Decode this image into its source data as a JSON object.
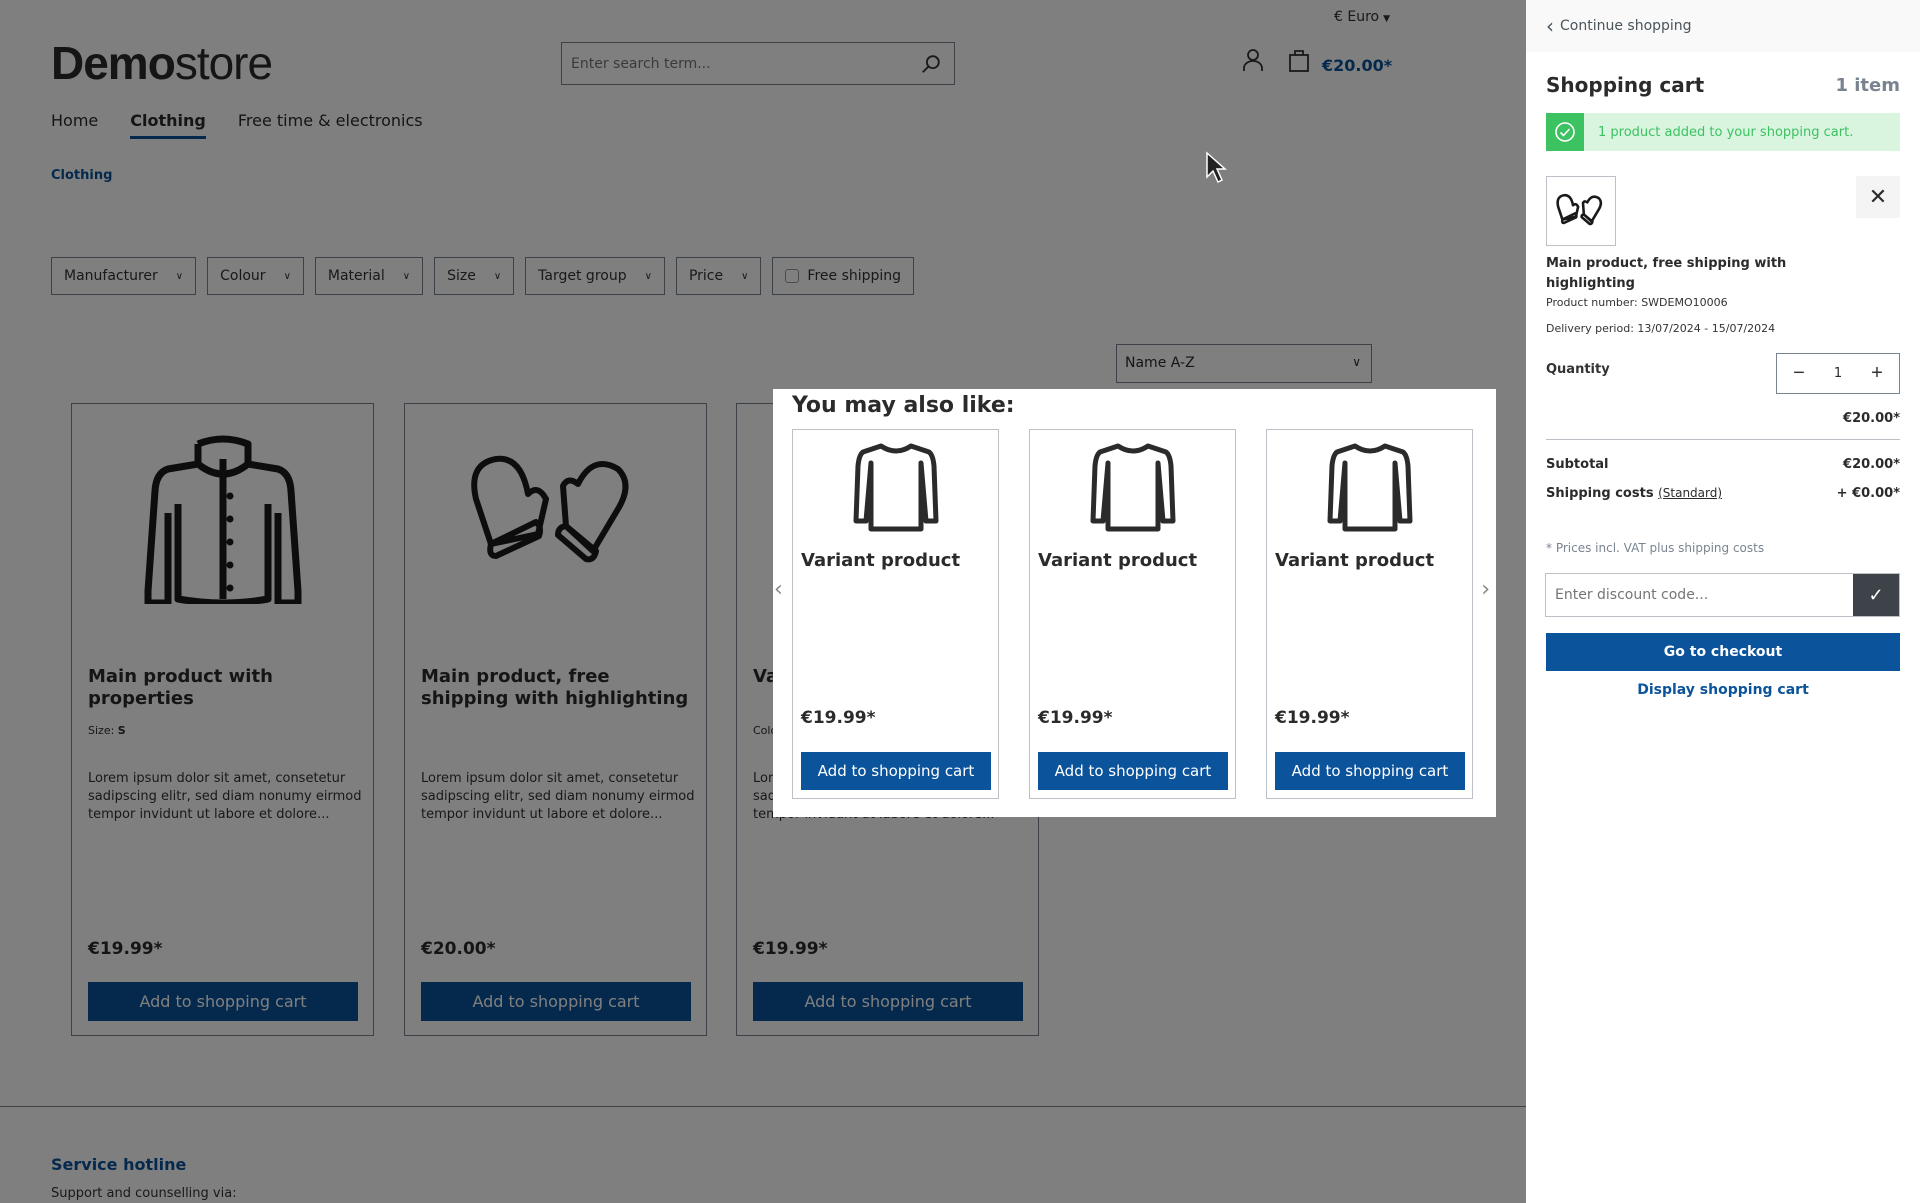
{
  "header": {
    "currency": "€ Euro",
    "logo_bold": "Demo",
    "logo_light": "store",
    "search_placeholder": "Enter search term...",
    "cart_total": "€20.00*"
  },
  "nav": {
    "items": [
      {
        "label": "Home",
        "active": false
      },
      {
        "label": "Clothing",
        "active": true
      },
      {
        "label": "Free time & electronics",
        "active": false
      }
    ]
  },
  "breadcrumb": "Clothing",
  "filters": [
    "Manufacturer",
    "Colour",
    "Material",
    "Size",
    "Target group",
    "Price"
  ],
  "free_shipping_label": "Free shipping",
  "sort": {
    "selected": "Name A-Z"
  },
  "products": [
    {
      "name": "Main product with properties",
      "prop_label": "Size:",
      "prop_value": "S",
      "desc": "Lorem ipsum dolor sit amet, consetetur sadipscing elitr, sed diam nonumy eirmod tempor invidunt ut labore et dolore...",
      "price": "€19.99*",
      "button": "Add to shopping cart",
      "image": "jacket-icon"
    },
    {
      "name": "Main product, free shipping with highlighting",
      "prop_label": "",
      "prop_value": "",
      "desc": "Lorem ipsum dolor sit amet, consetetur sadipscing elitr, sed diam nonumy eirmod tempor invidunt ut labore et dolore...",
      "price": "€20.00*",
      "button": "Add to shopping cart",
      "image": "mittens-icon"
    },
    {
      "name": "Variant product",
      "prop_label": "Colour:",
      "prop_value": "",
      "desc": "Lorem ipsum dolor sit amet, consetetur sadipscing elitr, sed diam nonumy eirmod tempor invidunt ut labore et dolore...",
      "price": "€19.99*",
      "button": "Add to shopping cart",
      "image": "shirt-icon"
    }
  ],
  "footer": {
    "title": "Service hotline",
    "text": "Support and counselling via:"
  },
  "modal": {
    "title": "You may also like:",
    "items": [
      {
        "name": "Variant product",
        "price": "€19.99*",
        "button": "Add to shopping cart"
      },
      {
        "name": "Variant product",
        "price": "€19.99*",
        "button": "Add to shopping cart"
      },
      {
        "name": "Variant product",
        "price": "€19.99*",
        "button": "Add to shopping cart"
      }
    ]
  },
  "cart": {
    "continue": "Continue shopping",
    "title": "Shopping cart",
    "count": "1 item",
    "alert": "1 product added to your shopping cart.",
    "item_name": "Main product, free shipping with highlighting",
    "product_number": "Product number: SWDEMO10006",
    "delivery": "Delivery period: 13/07/2024 - 15/07/2024",
    "quantity_label": "Quantity",
    "quantity": "1",
    "line_price": "€20.00*",
    "subtotal_label": "Subtotal",
    "subtotal": "€20.00*",
    "shipping_label": "Shipping costs",
    "shipping_method": "(Standard)",
    "shipping": "+ €0.00*",
    "note": "* Prices incl. VAT plus shipping costs",
    "discount_placeholder": "Enter discount code...",
    "checkout": "Go to checkout",
    "display_cart": "Display shopping cart"
  },
  "colors": {
    "brand": "#0b539b",
    "success": "#3cc261",
    "success_bg": "#d9f4df"
  }
}
